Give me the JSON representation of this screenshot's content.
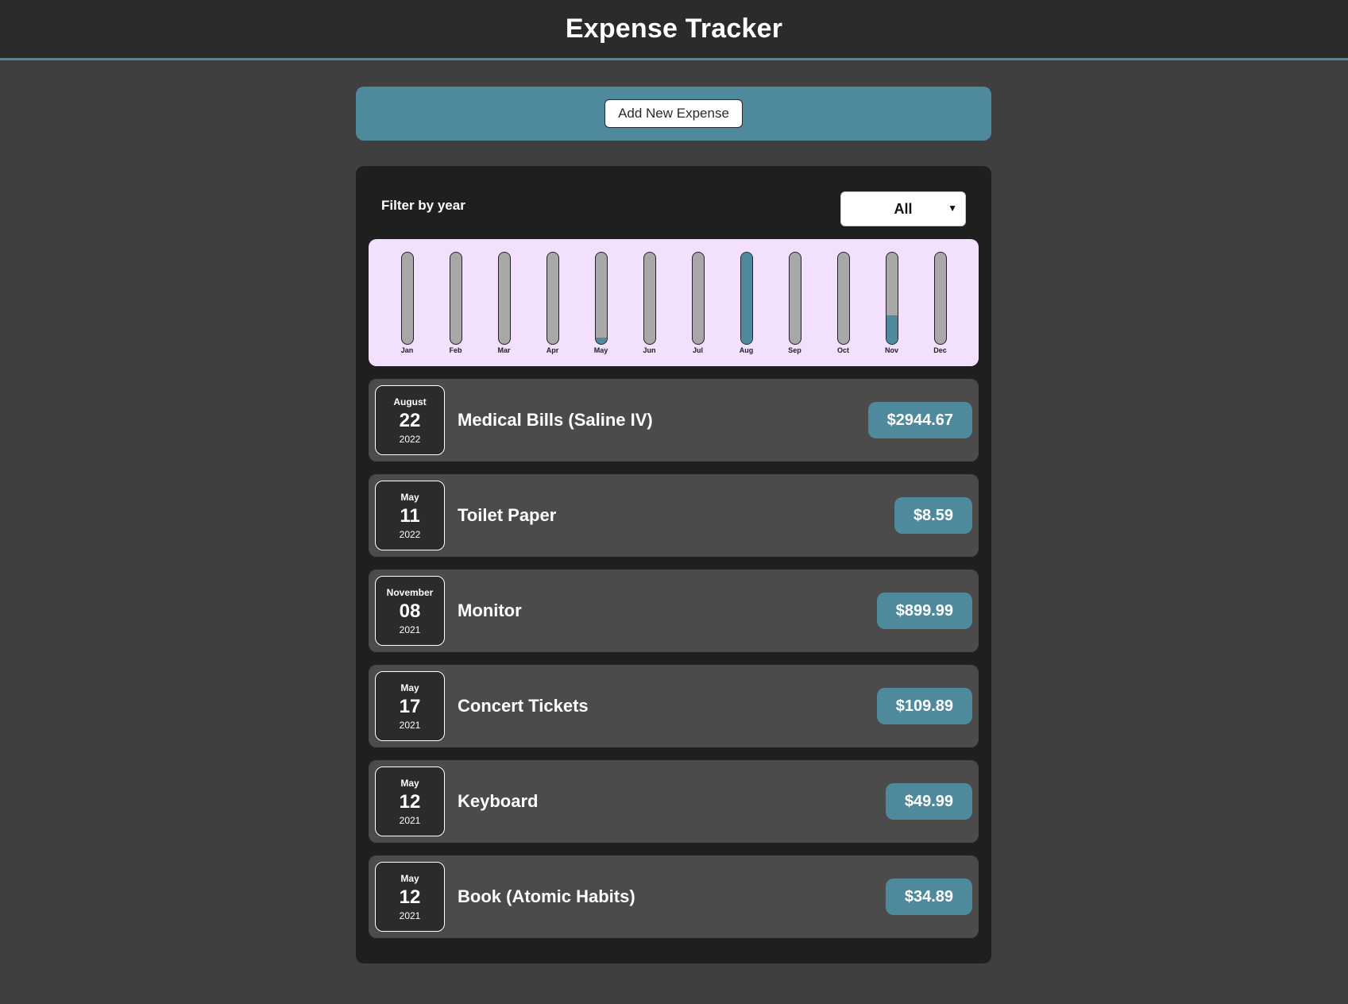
{
  "header": {
    "title": "Expense Tracker"
  },
  "new_expense": {
    "button_label": "Add New Expense"
  },
  "filter": {
    "label": "Filter by year",
    "selected": "All"
  },
  "colors": {
    "accent": "#4f8a9c",
    "chart_bg": "#f3e0fd",
    "bar_track": "#a8a8a8"
  },
  "chart_data": {
    "type": "bar",
    "categories": [
      "Jan",
      "Feb",
      "Mar",
      "Apr",
      "May",
      "Jun",
      "Jul",
      "Aug",
      "Sep",
      "Oct",
      "Nov",
      "Dec"
    ],
    "values": [
      0,
      0,
      0,
      0,
      0.07,
      0,
      0,
      1.0,
      0,
      0,
      0.31,
      0
    ],
    "ylim": [
      0,
      1
    ]
  },
  "expenses": [
    {
      "month": "August",
      "day": "22",
      "year": "2022",
      "title": "Medical Bills (Saline IV)",
      "amount": "$2944.67"
    },
    {
      "month": "May",
      "day": "11",
      "year": "2022",
      "title": "Toilet Paper",
      "amount": "$8.59"
    },
    {
      "month": "November",
      "day": "08",
      "year": "2021",
      "title": "Monitor",
      "amount": "$899.99"
    },
    {
      "month": "May",
      "day": "17",
      "year": "2021",
      "title": "Concert Tickets",
      "amount": "$109.89"
    },
    {
      "month": "May",
      "day": "12",
      "year": "2021",
      "title": "Keyboard",
      "amount": "$49.99"
    },
    {
      "month": "May",
      "day": "12",
      "year": "2021",
      "title": "Book (Atomic Habits)",
      "amount": "$34.89"
    }
  ]
}
